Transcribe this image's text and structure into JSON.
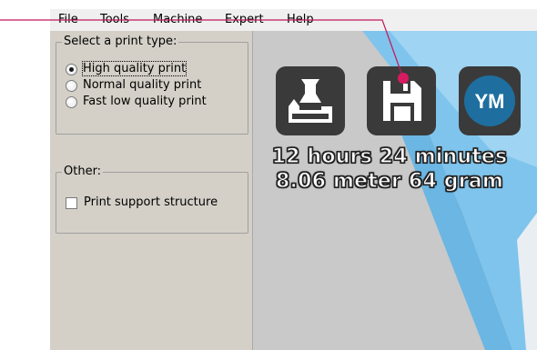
{
  "menu": {
    "items": [
      "File",
      "Tools",
      "Machine",
      "Expert",
      "Help"
    ]
  },
  "panel": {
    "print_type": {
      "title": "Select a print type:",
      "options": [
        "High quality print",
        "Normal quality print",
        "Fast low quality print"
      ],
      "selected": "High quality print"
    },
    "other": {
      "title": "Other:",
      "support_label": "Print support structure",
      "support_checked": false
    }
  },
  "view": {
    "buttons": [
      {
        "name": "load",
        "icon": "load-model-icon"
      },
      {
        "name": "save",
        "icon": "floppy-disk-icon"
      },
      {
        "name": "ym",
        "label": "YM",
        "icon": "youmagine-icon"
      }
    ],
    "print_time": "12 hours 24 minutes",
    "filament": "8.06 meter 64 gram"
  },
  "colors": {
    "callout": "#c2185b",
    "button_bg": "#3a3a3a",
    "ym_blue": "#1e6f9f",
    "sky_blue": "#7fc4ec"
  }
}
